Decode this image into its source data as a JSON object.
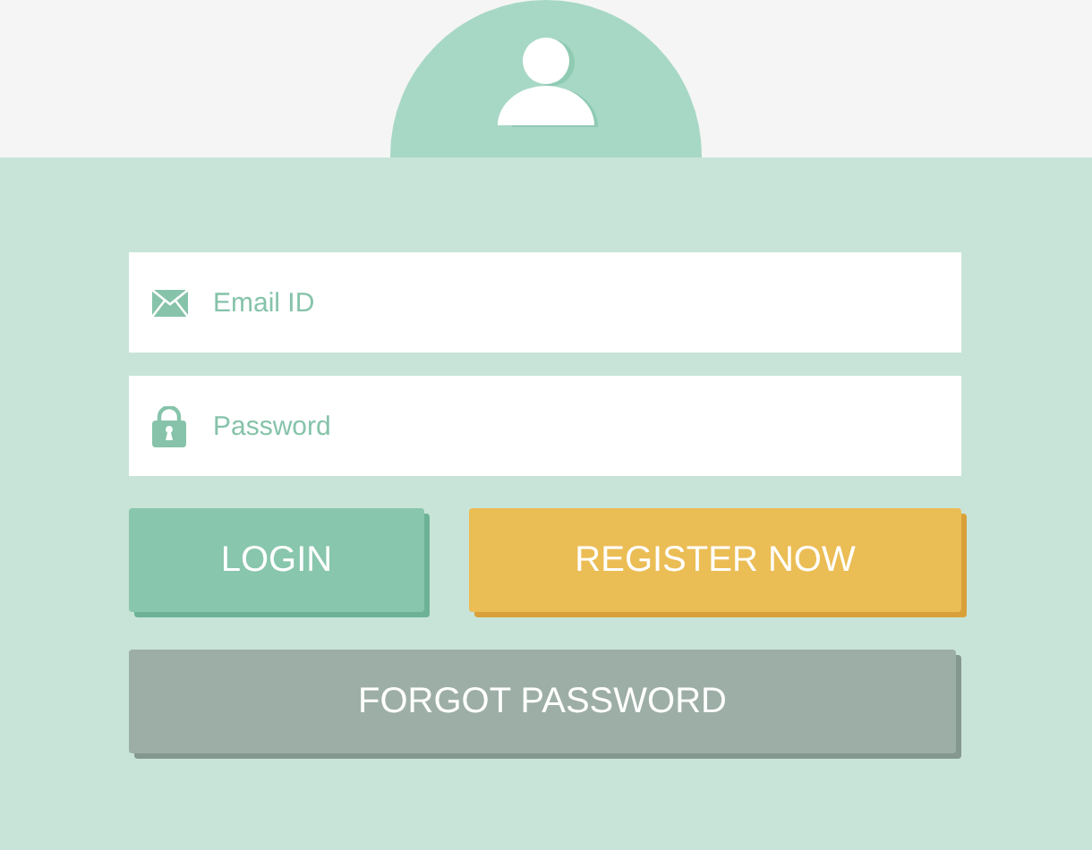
{
  "fields": [
    {
      "kind": "email",
      "placeholder": "Email ID"
    },
    {
      "kind": "password",
      "placeholder": "Password"
    }
  ],
  "buttons": [
    {
      "kind": "login",
      "label": "LOGIN"
    },
    {
      "kind": "register",
      "label": "REGISTER NOW"
    },
    {
      "kind": "forgot",
      "label": "FORGOT PASSWORD"
    }
  ]
}
